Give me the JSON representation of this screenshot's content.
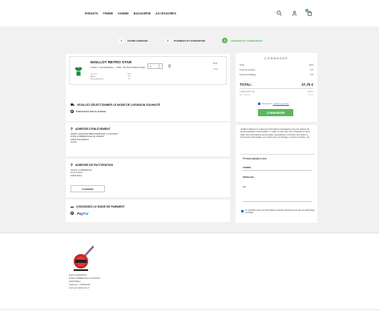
{
  "nav": [
    "ENFANTS",
    "FEMME",
    "HOMME",
    "BAGAGERIE",
    "ACCESSOIRES"
  ],
  "header_icons": [
    "search-icon",
    "user-icon",
    "cart-icon"
  ],
  "steps": [
    {
      "num": "1",
      "label": "VOTRE ADRESSE"
    },
    {
      "num": "2",
      "label": "PAIEMENT ET EXPÉDITION"
    },
    {
      "num": "3",
      "label": "VÉRIFIER ET COMMANDER"
    }
  ],
  "product": {
    "name": "MAILLOT RETRO STAR",
    "description": "Couleur : emeraude/blanc — Taille : T12 Nom/initiales brodés",
    "details": [
      {
        "label": "Prix TTC",
        "value": "19 €"
      },
      {
        "label": "Brodé",
        "value": "5 €"
      },
      {
        "label": "Personnalisation",
        "value": "5 €"
      }
    ],
    "quantity": "1",
    "price": "29 €",
    "sub": "Inclus",
    "color": "#1a8a3a"
  },
  "shipping_section": {
    "title": "VEUILLEZ SÉLECTIONNER LE MODE DE LIVRAISON SOUHAITÉ",
    "option": "Enlèvement chez le vendeur"
  },
  "store_section": {
    "title": "ADRESSE D'ENLÈVEMENT",
    "lines": [
      "SPORT 2000 MONTBRISON/PRIORY 22 SPORTS",
      "ZONE COMMERCIALE LE GRAVET",
      "42600 SAVIGNEUX",
      "France"
    ]
  },
  "billing_section": {
    "title": "ADRESSE DE FACTURATION",
    "lines": [
      "Anthony COMMENCAL",
      "22 du Gravet",
      "42600 Marie"
    ],
    "change_button": "CHANGER"
  },
  "payment_section": {
    "title": "CHOISISSEZ LE MODE DE PAIEMENT",
    "method_1": "Pay",
    "method_2": "Pal"
  },
  "summary": {
    "title": "COMMANDE",
    "rows": [
      {
        "label": "Total",
        "value": "29 €"
      },
      {
        "label": "Frais de livraison",
        "value": "0 €"
      },
      {
        "label": "Frais d'emballage",
        "value": "0 €"
      }
    ],
    "total_label": "TOTAL:",
    "total_value": "27,75 €",
    "tax_rows": [
      {
        "label": "TOTAL HORS TVA",
        "value": "23,13 €"
      },
      {
        "label": "dont TVA 20%",
        "value": "4,62 €"
      }
    ],
    "accept_text": "J'accepte les",
    "accept_link": "conditions générales",
    "order_button": "COMMANDER"
  },
  "note": "Veuillez indiquer ici toutes les informations nécessaires pour les options de personnalisation commandées. Il s'agit, en plus des noms d'artistes et de la taille, des informations personnelles nécessaires en fonction de l'option à l'impression demandée, un numéro pour un flocage, un texte à inscrire, etc...",
  "personalisation": {
    "title": "Personnalisation des",
    "name_label": "TORRO",
    "initials_label": "INITIALES :",
    "initials_value": "AC"
  },
  "consent_text": "Je souhaite entrer les informations requises directement au lieu de télécharger un fichier",
  "footer": {
    "lines": [
      "Anthony MADRIDAS",
      "ZONE COMMERCIALE LE GRAVET",
      "42600 BRIEU",
      "Téléphone : 0478901324",
      "sport.esport@armoire.fr"
    ],
    "logo_text": "SPORT 2000"
  }
}
